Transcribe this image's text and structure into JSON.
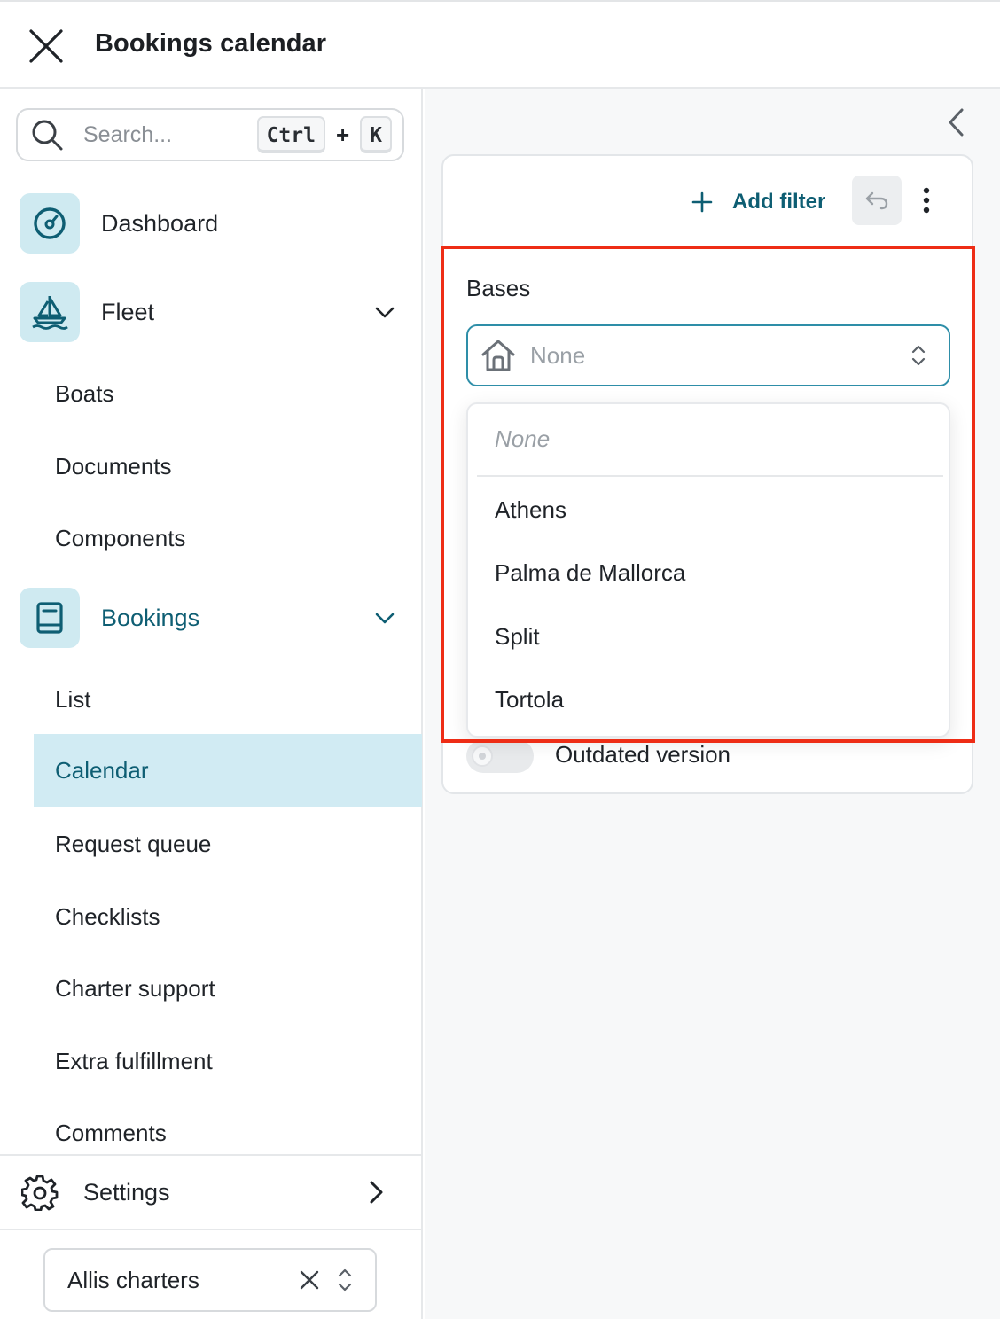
{
  "header": {
    "title": "Bookings calendar",
    "close_icon": "close-icon"
  },
  "sidebar": {
    "search": {
      "placeholder": "Search...",
      "shortcut_key1": "Ctrl",
      "shortcut_plus": "+",
      "shortcut_key2": "K"
    },
    "nav": {
      "dashboard": {
        "label": "Dashboard",
        "icon": "gauge-icon"
      },
      "fleet": {
        "label": "Fleet",
        "icon": "sailboat-icon",
        "items": [
          "Boats",
          "Documents",
          "Components"
        ]
      },
      "bookings": {
        "label": "Bookings",
        "icon": "book-icon",
        "items": [
          "List",
          "Calendar",
          "Request queue",
          "Checklists",
          "Charter support",
          "Extra fulfillment",
          "Comments"
        ],
        "selected": "Calendar"
      }
    },
    "settings": {
      "label": "Settings",
      "icon": "gear-icon"
    },
    "organization": {
      "label": "Allis charters"
    }
  },
  "main": {
    "filters": {
      "add_filter_label": "Add filter",
      "bases": {
        "label": "Bases",
        "selected_value": "None",
        "options_none": "None",
        "options": [
          "Athens",
          "Palma de Mallorca",
          "Split",
          "Tortola"
        ]
      },
      "outdated_version_label": "Outdated version",
      "outdated_version_on": false
    }
  },
  "colors": {
    "accent": "#0e5e73",
    "selected_bg": "#d1ebf3",
    "icon_bg": "#cfeaf1",
    "focus_border": "#2e8ea8",
    "highlight_red": "#ee2d16"
  }
}
